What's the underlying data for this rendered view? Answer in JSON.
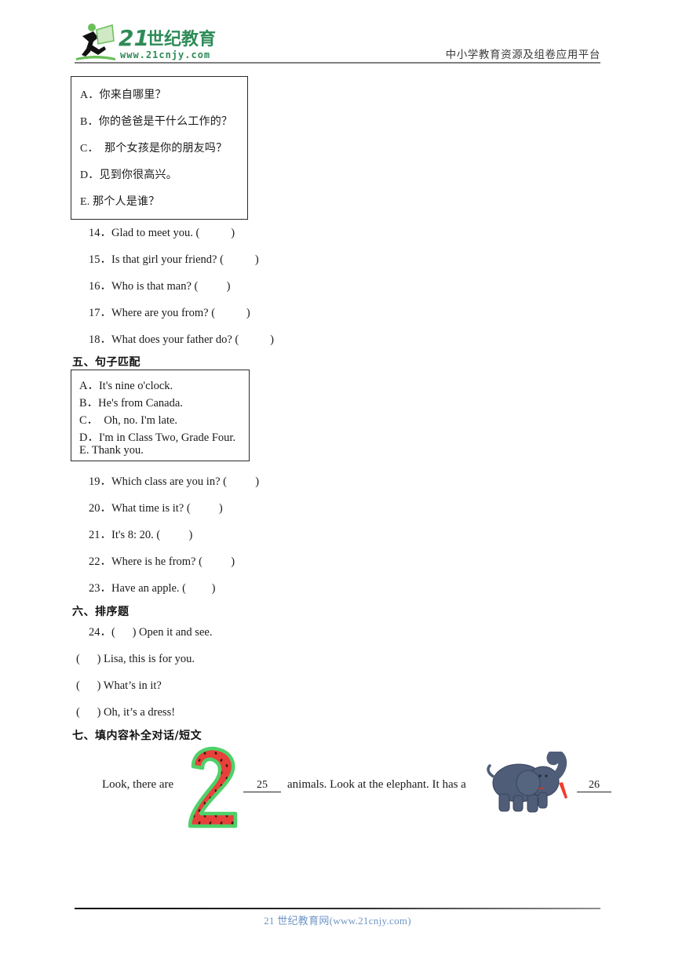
{
  "header": {
    "logo_number": "21",
    "logo_text": "世纪教育",
    "logo_url": "www.21cnjy.com",
    "tagline": "中小学教育资源及组卷应用平台",
    "brand_color": "#2e8b57",
    "runner_icon": "running-person-icon"
  },
  "chinese_options_box": {
    "options": [
      "A．你来自哪里？",
      "B．你的爸爸是干什么工作的？",
      "C．  那个女孩是你的朋友吗？",
      "D．见到你很高兴。",
      "E. 那个人是谁？"
    ]
  },
  "matching_questions_1": [
    "14．Glad to meet you. (           )",
    "15．Is that girl your friend? (           )",
    "16．Who is that man? (          )",
    "17．Where are you from? (           )",
    "18．What does your father do? (           )"
  ],
  "section_five": {
    "heading": "五、句子匹配",
    "options": [
      "A．It's nine o'clock.",
      "B．He's from Canada.",
      "C．  Oh, no. I'm late.",
      "D．I'm in Class Two, Grade Four.",
      "E. Thank you."
    ],
    "questions": [
      "19．Which class are you in? (          )",
      "20．What time is it? (          )",
      "21．It's 8: 20. (          )",
      "22．Where is he from? (          )",
      "23．Have an apple. (         )"
    ]
  },
  "section_six": {
    "heading": "六、排序题",
    "items": [
      "24．(      ) Open it and see.",
      "(      ) Lisa, this is for you.",
      "(      ) What’s in it?",
      "(      ) Oh, it’s a dress!"
    ]
  },
  "section_seven": {
    "heading": "七、填内容补全对话/短文",
    "cloze_part1": "Look, there are",
    "blank_25": "25",
    "cloze_part2": "animals. Look at the elephant. It has a",
    "blank_26": "26",
    "image_two": "watermelon-number-two-image",
    "image_elephant": "elephant-image",
    "two_fill_color": "#e8403a",
    "two_outline_color": "#4fd16a",
    "elephant_color": "#4f5d78",
    "arrow_color": "#f03c2e"
  },
  "footer": {
    "text": "21 世纪教育网(www.21cnjy.com)",
    "color": "#6f96c4"
  }
}
